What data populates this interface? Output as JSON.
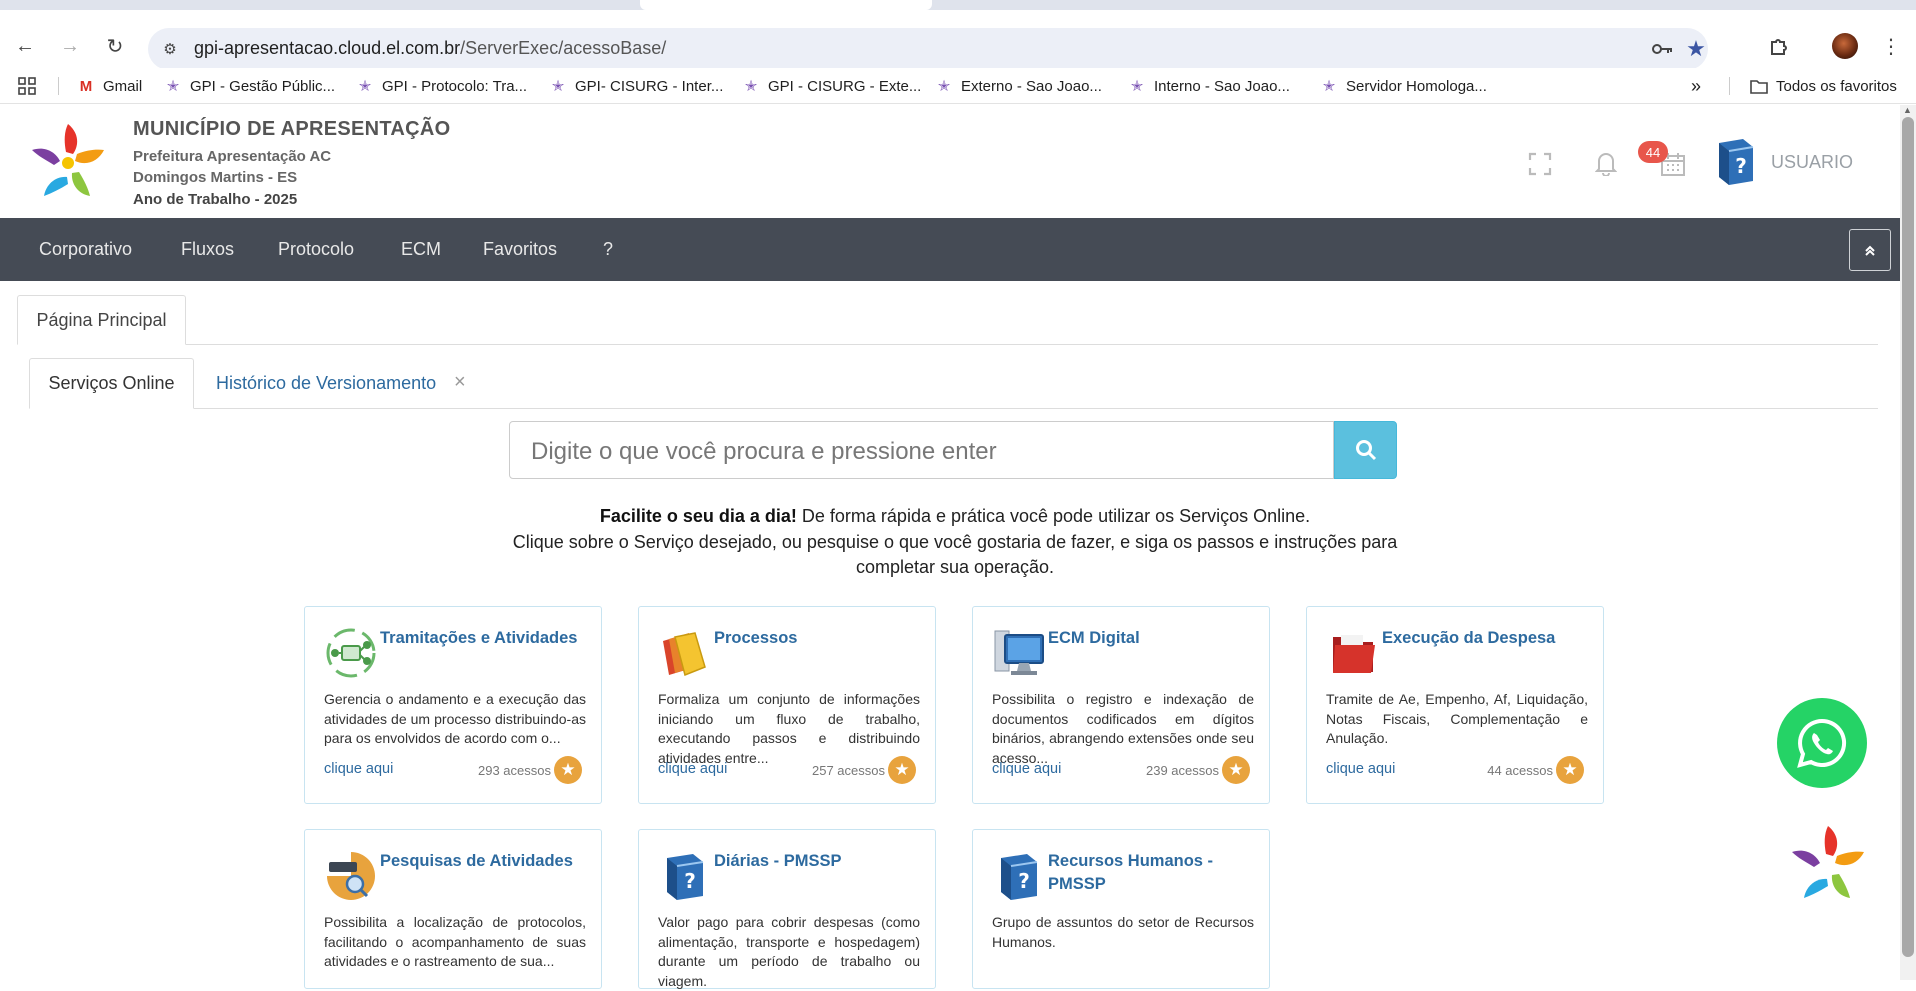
{
  "browser": {
    "url_host": "gpi-apresentacao.cloud.el.com.br",
    "url_path": "/ServerExec/acessoBase/",
    "bookmarks": [
      {
        "label": "Gmail",
        "icon": "gmail-icon"
      },
      {
        "label": "GPI - Gestão Públic...",
        "icon": "gpi-star-icon"
      },
      {
        "label": "GPI - Protocolo: Tra...",
        "icon": "gpi-star-icon"
      },
      {
        "label": "GPI- CISURG - Inter...",
        "icon": "gpi-star-icon"
      },
      {
        "label": "GPI - CISURG - Exte...",
        "icon": "gpi-star-icon"
      },
      {
        "label": "Externo - Sao Joao...",
        "icon": "gpi-star-icon"
      },
      {
        "label": "Interno - Sao Joao...",
        "icon": "gpi-star-icon"
      },
      {
        "label": "Servidor Homologa...",
        "icon": "gpi-star-icon"
      }
    ],
    "more_bookmarks": "»",
    "all_favorites": "Todos os favoritos"
  },
  "header": {
    "municipality": "MUNICÍPIO DE APRESENTAÇÃO",
    "line1": "Prefeitura Apresentação AC",
    "line2": "Domingos Martins - ES",
    "line3": "Ano de Trabalho - 2025",
    "notification_count": "44",
    "user_label": "USUARIO"
  },
  "menu": [
    "Corporativo",
    "Fluxos",
    "Protocolo",
    "ECM",
    "Favoritos",
    "?"
  ],
  "tabs": {
    "main": "Página Principal",
    "sub": [
      "Serviços Online",
      "Histórico de Versionamento"
    ],
    "close_glyph": "×"
  },
  "search": {
    "placeholder": "Digite o que você procura e pressione enter"
  },
  "intro": {
    "bold": "Facilite o seu dia a dia!",
    "line1_rest": " De forma rápida e prática você pode utilizar os Serviços Online.",
    "line2": "Clique sobre o Serviço desejado, ou pesquise o que você gostaria de fazer, e siga os passos e instruções para completar sua operação."
  },
  "cards": [
    {
      "title": "Tramitações e Atividades",
      "desc": "Gerencia o andamento e a execução das atividades de um processo distribuindo-as para os envolvidos de acordo com o...",
      "link": "clique aqui",
      "count": "293 acessos",
      "icon": "workflow-icon"
    },
    {
      "title": "Processos",
      "desc": "Formaliza um conjunto de informações iniciando um fluxo de trabalho, executando passos e distribuindo atividades entre...",
      "link": "clique aqui",
      "count": "257 acessos",
      "icon": "folders-icon"
    },
    {
      "title": "ECM Digital",
      "desc": "Possibilita o registro e indexação de documentos codificados em dígitos binários, abrangendo extensões onde seu acesso...",
      "link": "clique aqui",
      "count": "239 acessos",
      "icon": "computer-icon"
    },
    {
      "title": "Execução da Despesa",
      "desc": "Tramite de Ae, Empenho, Af, Liquidação, Notas Fiscais, Complementação e Anulação.",
      "link": "clique aqui",
      "count": "44 acessos",
      "icon": "red-folder-icon"
    },
    {
      "title": "Pesquisas de Atividades",
      "desc": "Possibilita a localização de protocolos, facilitando o acompanhamento de suas atividades e o rastreamento de sua...",
      "icon": "search-card-icon"
    },
    {
      "title": "Diárias - PMSSP",
      "desc": "Valor pago para cobrir despesas (como alimentação, transporte e hospedagem) durante um período de trabalho ou viagem.",
      "icon": "help-book-icon"
    },
    {
      "title": "Recursos Humanos - PMSSP",
      "desc": "Grupo de assuntos do setor de Recursos Humanos.",
      "icon": "help-book-icon"
    }
  ],
  "colors": {
    "menubar": "#454b55",
    "link": "#2d6a9f",
    "search_button": "#5bc0de",
    "star": "#e8a33d",
    "badge": "#e8564b",
    "whatsapp": "#25d366"
  }
}
